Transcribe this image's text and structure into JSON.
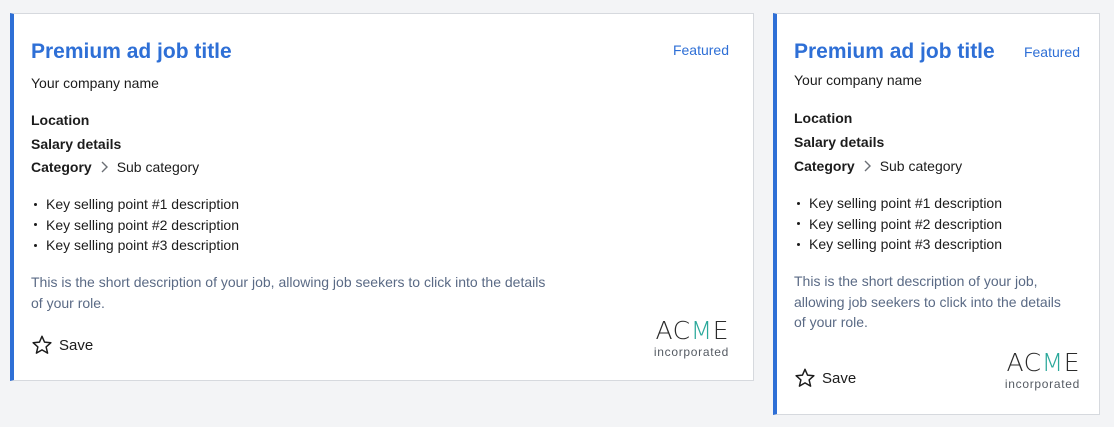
{
  "colors": {
    "accent": "#2e6fd6",
    "description_text": "#5a6a85",
    "logo_accent": "#2aa89a",
    "background": "#f3f4f6"
  },
  "cards": [
    {
      "layout": "wide",
      "title": "Premium ad job title",
      "featured": "Featured",
      "company": "Your company name",
      "location": "Location",
      "salary": "Salary details",
      "category": "Category",
      "category_separator_icon": "chevron-right-icon",
      "sub_category": "Sub category",
      "selling_points": [
        "Key selling point #1 description",
        "Key selling point #2 description",
        "Key selling point #3 description"
      ],
      "description_lines": [
        "This is the short description of your job, allowing job seekers to click into the details",
        "of your role."
      ],
      "save_icon": "star-outline-icon",
      "save_label": "Save",
      "logo": {
        "name_pre": "AC",
        "name_accent": "M",
        "name_post": "E",
        "tagline": "incorporated"
      }
    },
    {
      "layout": "narrow",
      "title": "Premium ad job title",
      "featured": "Featured",
      "company": "Your company name",
      "location": "Location",
      "salary": "Salary details",
      "category": "Category",
      "category_separator_icon": "chevron-right-icon",
      "sub_category": "Sub category",
      "selling_points": [
        "Key selling point #1 description",
        "Key selling point #2 description",
        "Key selling point #3 description"
      ],
      "description_lines": [
        "This is the short description of your job,",
        "allowing job seekers to click into the details",
        "of your role."
      ],
      "save_icon": "star-outline-icon",
      "save_label": "Save",
      "logo": {
        "name_pre": "AC",
        "name_accent": "M",
        "name_post": "E",
        "tagline": "incorporated"
      }
    }
  ]
}
